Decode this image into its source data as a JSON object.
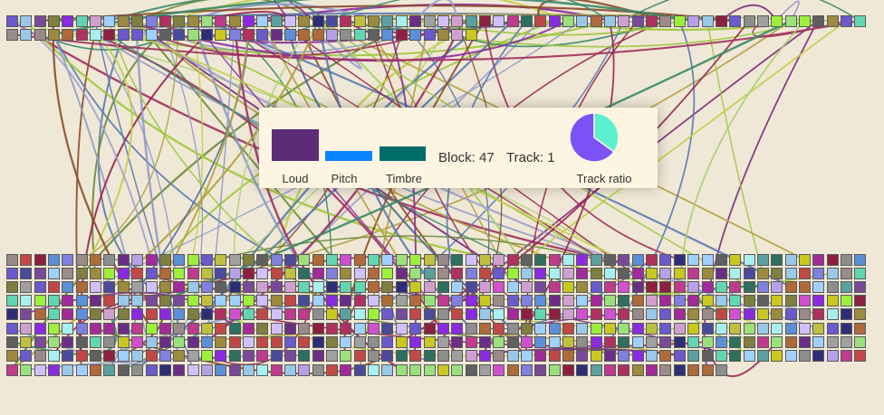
{
  "panel": {
    "metrics": [
      {
        "label": "Loud",
        "color": "#5e2b79"
      },
      {
        "label": "Pitch",
        "color": "#0a84ff"
      },
      {
        "label": "Timbre",
        "color": "#006c6a"
      }
    ],
    "block_label": "Block: 47",
    "track_label": "Track: 1",
    "pie": {
      "label": "Track ratio",
      "colors": [
        "#7a52f5",
        "#5cf0cf"
      ]
    }
  },
  "palette": [
    "#6b2e86",
    "#c03a8e",
    "#9c8a3f",
    "#a22a9a",
    "#a8f0f0",
    "#c24848",
    "#b03060",
    "#8080e0",
    "#606060",
    "#5b8fd8",
    "#9ac8e8",
    "#2f6f5f",
    "#8e8e8e",
    "#9be07d",
    "#b8a0e8",
    "#9b8a8a",
    "#4b4b9b",
    "#62d6b0",
    "#7a4a9a",
    "#9cf03c",
    "#6a5acd",
    "#2e2e78",
    "#8a2be2",
    "#c8c820",
    "#a0a0a0",
    "#d0c0ff",
    "#af6a3a",
    "#5aa0a0",
    "#8f1f3f",
    "#cfa0cf",
    "#bfc040",
    "#a0d0ff",
    "#d050d0",
    "#7f7f3f"
  ],
  "link_colors": [
    "#9a2050",
    "#8a2aa0",
    "#9bc63a",
    "#8f9ac8",
    "#a8d070",
    "#6a8a3a",
    "#7a2a7a",
    "#b0a040",
    "#4a6a9a",
    "#a03060",
    "#c0d050",
    "#5a7ab0",
    "#a0a0d0",
    "#8a4a2a",
    "#3a8a6a"
  ]
}
